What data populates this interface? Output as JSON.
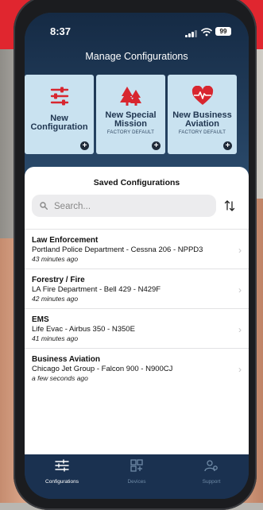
{
  "status_bar": {
    "time": "8:37",
    "battery": "99"
  },
  "screen_title": "Manage Configurations",
  "tiles": [
    {
      "label_line1": "New",
      "label_line2": "Configuration",
      "subtitle": "",
      "icon": "sliders-icon"
    },
    {
      "label_line1": "New Special",
      "label_line2": "Mission",
      "subtitle": "FACTORY DEFAULT",
      "icon": "trees-icon"
    },
    {
      "label_line1": "New Business",
      "label_line2": "Aviation",
      "subtitle": "FACTORY DEFAULT",
      "icon": "heart-pulse-icon"
    }
  ],
  "saved": {
    "title": "Saved Configurations",
    "search_placeholder": "Search...",
    "items": [
      {
        "category": "Law Enforcement",
        "description": "Portland Police Department  - Cessna 206 - NPPD3",
        "time_ago": "43 minutes ago"
      },
      {
        "category": "Forestry / Fire",
        "description": "LA Fire Department - Bell 429 - N429F",
        "time_ago": "42 minutes ago"
      },
      {
        "category": "EMS",
        "description": "Life Evac - Airbus 350 - N350E",
        "time_ago": "41 minutes ago"
      },
      {
        "category": "Business Aviation",
        "description": "Chicago Jet Group - Falcon 900 - N900CJ",
        "time_ago": "a few seconds ago"
      }
    ]
  },
  "tabbar": {
    "tabs": [
      {
        "label": "Configurations",
        "icon": "sliders-icon",
        "active": true
      },
      {
        "label": "Devices",
        "icon": "devices-icon",
        "active": false
      },
      {
        "label": "Support",
        "icon": "support-icon",
        "active": false
      }
    ]
  },
  "colors": {
    "accent_red": "#e0262f",
    "tile_bg": "#c9e2f0",
    "navy": "#1a3150"
  }
}
